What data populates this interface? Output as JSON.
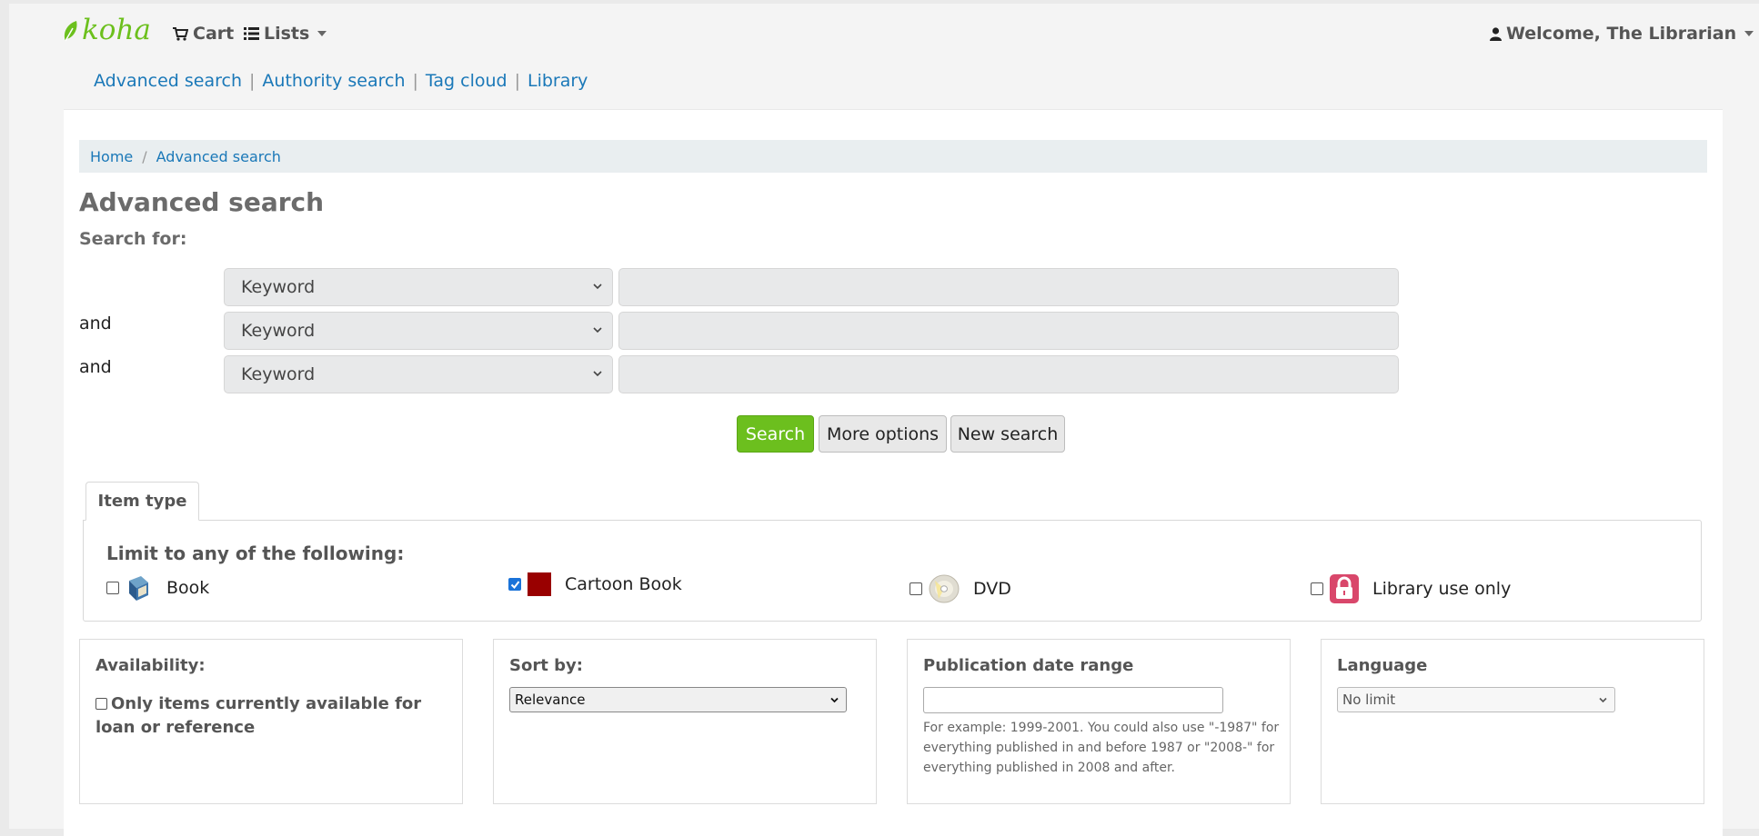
{
  "app": {
    "logo_text": "koha",
    "cart_label": "Cart",
    "lists_label": "Lists",
    "user_menu_label": "Welcome, The Librarian"
  },
  "subnav": [
    "Advanced search",
    "Authority search",
    "Tag cloud",
    "Library"
  ],
  "subnav_separator": "|",
  "breadcrumb": {
    "home": "Home",
    "separator": "/",
    "current": "Advanced search"
  },
  "page_title": "Advanced search",
  "search_for_label": "Search for:",
  "search_rows": [
    {
      "operator": "",
      "index": "Keyword",
      "value": ""
    },
    {
      "operator": "and",
      "index": "Keyword",
      "value": ""
    },
    {
      "operator": "and",
      "index": "Keyword",
      "value": ""
    }
  ],
  "buttons": {
    "search": "Search",
    "more_options": "More options",
    "new_search": "New search"
  },
  "tabs": [
    {
      "label": "Item type",
      "active": true
    }
  ],
  "item_types": {
    "heading": "Limit to any of the following:",
    "items": [
      {
        "label": "Book",
        "checked": false,
        "icon": "book-icon"
      },
      {
        "label": "Cartoon Book",
        "checked": true,
        "icon": "red-square-icon"
      },
      {
        "label": "DVD",
        "checked": false,
        "icon": "dvd-disc-icon"
      },
      {
        "label": "Library use only",
        "checked": false,
        "icon": "padlock-icon"
      }
    ]
  },
  "availability": {
    "title": "Availability:",
    "option": "Only items currently available for loan or reference",
    "checked": false
  },
  "sort": {
    "title": "Sort by:",
    "selected": "Relevance"
  },
  "pubdate": {
    "title": "Publication date range",
    "value": "",
    "hint": "For example: 1999-2001. You could also use \"-1987\" for everything published in and before 1987 or \"2008-\" for everything published in 2008 and after."
  },
  "language": {
    "title": "Language",
    "selected": "No limit"
  },
  "colors": {
    "brand_green": "#6cbf1e",
    "link_blue": "#1a78b8",
    "checkbox_blue": "#1a73d9",
    "cartoon_book_red": "#990000"
  }
}
